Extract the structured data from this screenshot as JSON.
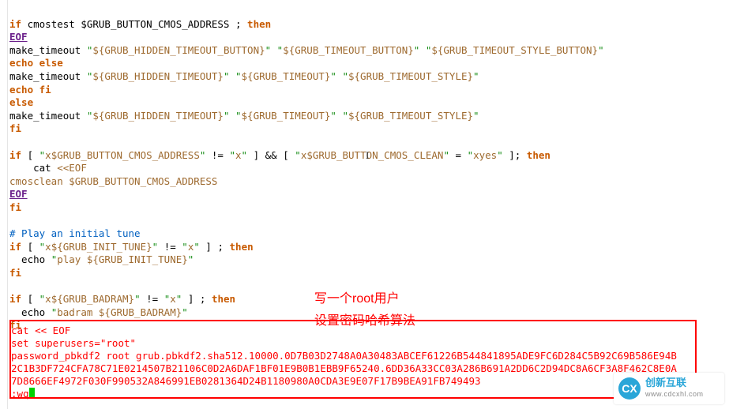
{
  "lines": {
    "l1_if": "if",
    "l1_rest": " cmostest $GRUB_BUTTON_CMOS_ADDRESS ; ",
    "l1_then": "then",
    "l2_eof": "EOF",
    "l3_cmd": "make_timeout ",
    "l3_q": "\"",
    "l3_a": "${GRUB_HIDDEN_TIMEOUT_BUTTON}",
    "l3_b": "${GRUB_TIMEOUT_BUTTON}",
    "l3_c": "${GRUB_TIMEOUT_STYLE_BUTTON}",
    "l4_echo": "echo",
    "l4_sp": " ",
    "l4_else": "else",
    "l5_cmd": "make_timeout ",
    "l5_a": "${GRUB_HIDDEN_TIMEOUT}",
    "l5_b": "${GRUB_TIMEOUT}",
    "l5_c": "${GRUB_TIMEOUT_STYLE}",
    "l6_echo": "echo",
    "l6_sp": " ",
    "l6_fi": "fi",
    "l7_else": "else",
    "l8_cmd": "make_timeout ",
    "l9_fi": "fi",
    "l11_if": "if",
    "l11_mid1": " [ ",
    "l11_x1": "x$GRUB_BUTTON_CMOS_ADDRESS",
    "l11_ne": " != ",
    "l11_x2": "x",
    "l11_mid2": " ] ",
    "l11_and": "&&",
    "l11_mid3": " [ ",
    "l11_x3": "x$GRUB_BUTTON_CMOS_CLEAN",
    "l11_eq": " = ",
    "l11_x4": "xyes",
    "l11_end": " ]; ",
    "l11_then": "then",
    "l12_cat": "    cat ",
    "l12_heredoc": "<<EOF",
    "l13_txt": "cmosclean $GRUB_BUTTON_CMOS_ADDRESS",
    "l14_eof": "EOF",
    "l15_fi": "fi",
    "l17_cmt": "# Play an initial tune",
    "l18_if": "if",
    "l18_mid1": " [ ",
    "l18_x1": "x${GRUB_INIT_TUNE}",
    "l18_ne": " != ",
    "l18_x2": "x",
    "l18_end": " ] ; ",
    "l18_then": "then",
    "l19_echo": "  echo ",
    "l19_str": "play ${GRUB_INIT_TUNE}",
    "l20_fi": "fi",
    "l22_if": "if",
    "l22_mid1": " [ ",
    "l22_x1": "x${GRUB_BADRAM}",
    "l22_ne": " != ",
    "l22_x2": "x",
    "l22_end": " ] ; ",
    "l22_then": "then",
    "l23_echo": "  echo ",
    "l23_str": "badram ${GRUB_BADRAM}",
    "l24_fi": "fi"
  },
  "redblock": {
    "r1": "cat << EOF",
    "r2": "set superusers=\"root\"",
    "r3": "password_pbkdf2 root grub.pbkdf2.sha512.10000.0D7B03D2748A0A30483ABCEF61226B544841895ADE9FC6D284C5B92C69B586E94B",
    "r4": "2C1B3DF724CFA78C71E0214507B21106C0D2A6DAF1BF01E9B0B1EBB9F65240.6DD36A33CC03A286B691A2DD6C2D94DC8A6CF3A8F462C8E0A",
    "r5": "7D8666EF4972F030F990532A846991EB0281364D24B1180980A0CDA3E9E07F17B9BEA91FB749493",
    "r6": ":wq"
  },
  "annotations": {
    "a1": "写一个root用户",
    "a2": "设置密码哈希算法"
  },
  "logo": {
    "glyph": "CX",
    "line1": "创新互联",
    "line2": "www.cdcxhl.com"
  }
}
